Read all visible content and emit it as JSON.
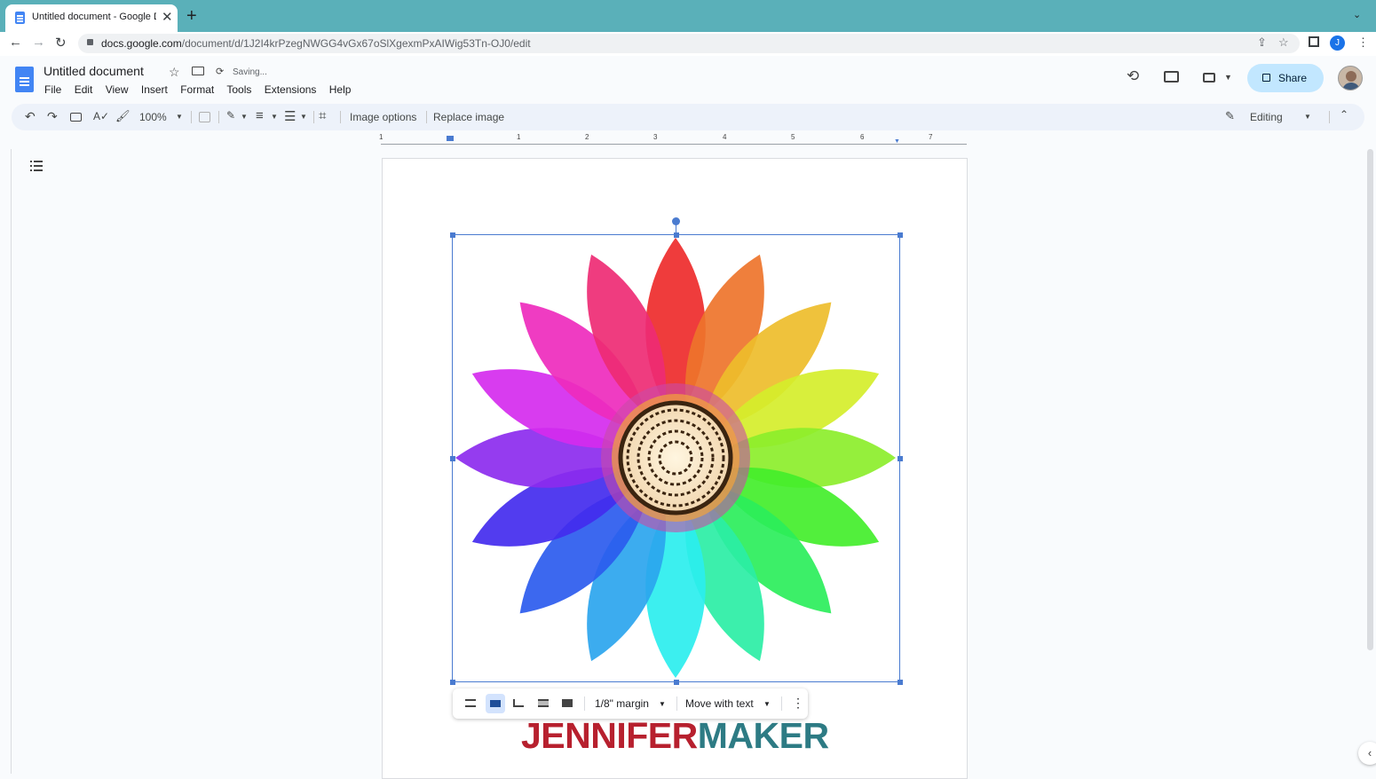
{
  "browser": {
    "tab_title": "Untitled document - Google Dc",
    "url_host": "docs.google.com",
    "url_path": "/document/d/1J2I4krPzegNWGG4vGx67oSlXgexmPxAIWig53Tn-OJ0/edit",
    "profile_initial": "J"
  },
  "doc": {
    "title": "Untitled document",
    "status": "Saving...",
    "menus": [
      "File",
      "Edit",
      "View",
      "Insert",
      "Format",
      "Tools",
      "Extensions",
      "Help"
    ],
    "share_label": "Share"
  },
  "toolbar": {
    "zoom": "100%",
    "image_options": "Image options",
    "replace_image": "Replace image",
    "mode": "Editing"
  },
  "ruler": {
    "marks": [
      "1",
      "1",
      "2",
      "3",
      "4",
      "5",
      "6",
      "7"
    ]
  },
  "image_toolbar": {
    "margin": "1/8\" margin",
    "position": "Move with text"
  },
  "watermark": {
    "part1": "JENNIFER",
    "part2": "MAKER"
  },
  "colors": {
    "tabbar": "#5ab0b9",
    "share_bg": "#c2e7ff",
    "selection": "#4a7bd0",
    "logo_red": "#b7202e",
    "logo_teal": "#2d7b84"
  }
}
